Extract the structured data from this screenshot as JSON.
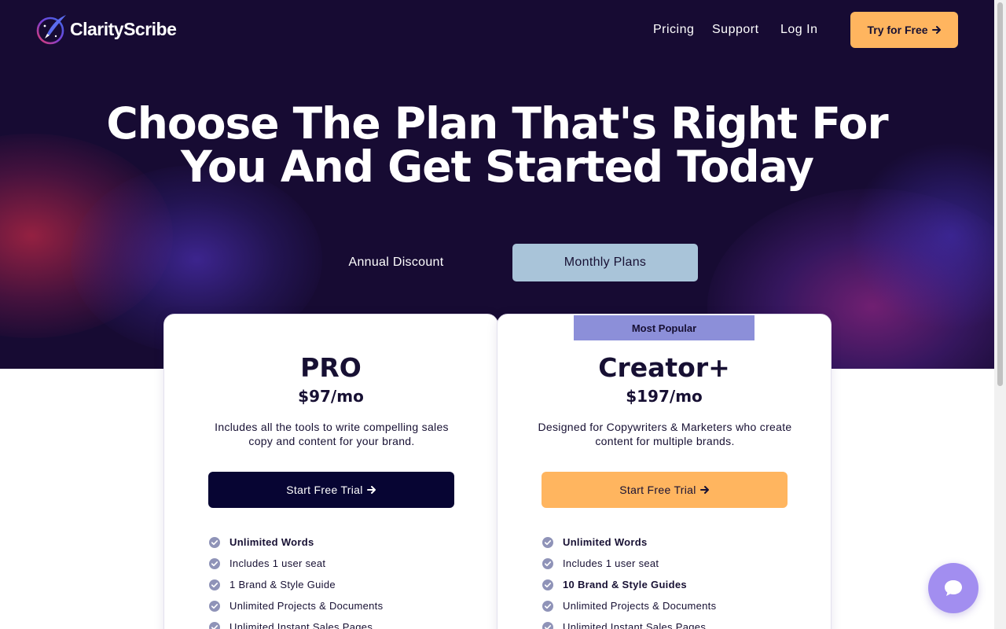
{
  "brand": {
    "name": "ClarityScribe"
  },
  "nav": {
    "links": [
      "Pricing",
      "Support",
      "Log In"
    ],
    "cta_label": "Try for Free"
  },
  "hero": {
    "headline_line1": "Choose The Plan That's Right For",
    "headline_line2": "You And Get Started Today"
  },
  "billing_toggle": {
    "annual_label": "Annual Discount",
    "monthly_label": "Monthly Plans",
    "selected": "Monthly Plans"
  },
  "plans": [
    {
      "name": "PRO",
      "price": "$97/mo",
      "description": "Includes all the tools to write compelling sales copy and content for your brand.",
      "cta_label": "Start Free Trial",
      "features": [
        {
          "text": "Unlimited Words",
          "bold": true
        },
        {
          "text": "Includes 1 user seat",
          "bold": false
        },
        {
          "text": "1 Brand & Style Guide",
          "bold": false
        },
        {
          "text": "Unlimited Projects & Documents",
          "bold": false
        },
        {
          "text": "Unlimited Instant Sales Pages",
          "bold": false
        }
      ]
    },
    {
      "name": "Creator+",
      "badge": "Most Popular",
      "price": "$197/mo",
      "description": "Designed for Copywriters & Marketers who create content for multiple brands.",
      "cta_label": "Start Free Trial",
      "features": [
        {
          "text": "Unlimited Words",
          "bold": true
        },
        {
          "text": "Includes 1 user seat",
          "bold": false
        },
        {
          "text": "10 Brand & Style Guides",
          "bold": true
        },
        {
          "text": "Unlimited Projects & Documents",
          "bold": false
        },
        {
          "text": "Unlimited Instant Sales Pages",
          "bold": false
        }
      ]
    }
  ],
  "colors": {
    "hero_bg": "#170b33",
    "accent_orange": "#ffb55f",
    "dark_navy": "#070533",
    "toggle_selected": "#a9c4d9",
    "badge": "#8c8fd9",
    "check": "#8f93b8",
    "chat": "#a28ef0"
  },
  "icons": {
    "logo": "quill-logo-icon",
    "arrow": "arrow-right-icon",
    "check": "check-circle-icon",
    "chat": "chat-bubble-icon"
  }
}
